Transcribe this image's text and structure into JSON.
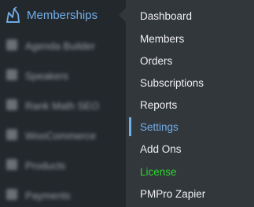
{
  "active_menu": {
    "label": "Memberships",
    "icon": "memberships-icon"
  },
  "submenu": {
    "items": [
      {
        "label": "Dashboard"
      },
      {
        "label": "Members"
      },
      {
        "label": "Orders"
      },
      {
        "label": "Subscriptions"
      },
      {
        "label": "Reports"
      },
      {
        "label": "Settings",
        "current": true
      },
      {
        "label": "Add Ons"
      },
      {
        "label": "License",
        "highlight_color": "#2fd22f"
      },
      {
        "label": "PMPro Zapier"
      }
    ]
  },
  "blurred_menu": {
    "items": [
      {
        "label": "Agenda Builder"
      },
      {
        "label": "Speakers"
      },
      {
        "label": "Rank Math SEO"
      },
      {
        "label": "WooCommerce"
      },
      {
        "label": "Products"
      },
      {
        "label": "Payments"
      }
    ]
  },
  "colors": {
    "sidebar_bg": "#23282d",
    "submenu_bg": "#32373c",
    "accent": "#72aee6",
    "text": "#f0f0f1",
    "license": "#2fd22f"
  }
}
